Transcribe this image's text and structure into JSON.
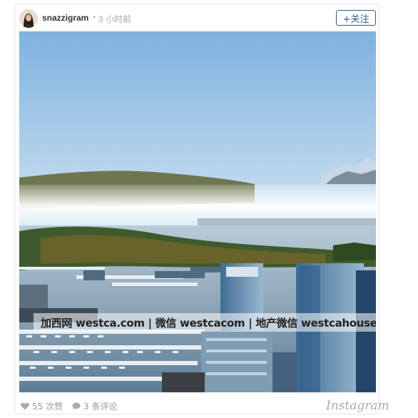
{
  "post": {
    "username": "snazzigram",
    "separator": "•",
    "time": "3 小时前",
    "follow_label": "+关注"
  },
  "photo": {
    "watermark": "加西网 westca.com | 微信 westcacom | 地产微信 westcahouse"
  },
  "footer": {
    "likes": "55 次赞",
    "comments": "3 条评论",
    "brand": "Instagram"
  },
  "icons": {
    "heart": "heart-icon",
    "comment": "comment-icon"
  },
  "colors": {
    "follow_border": "#2d5b85",
    "meta_text": "#999999"
  }
}
